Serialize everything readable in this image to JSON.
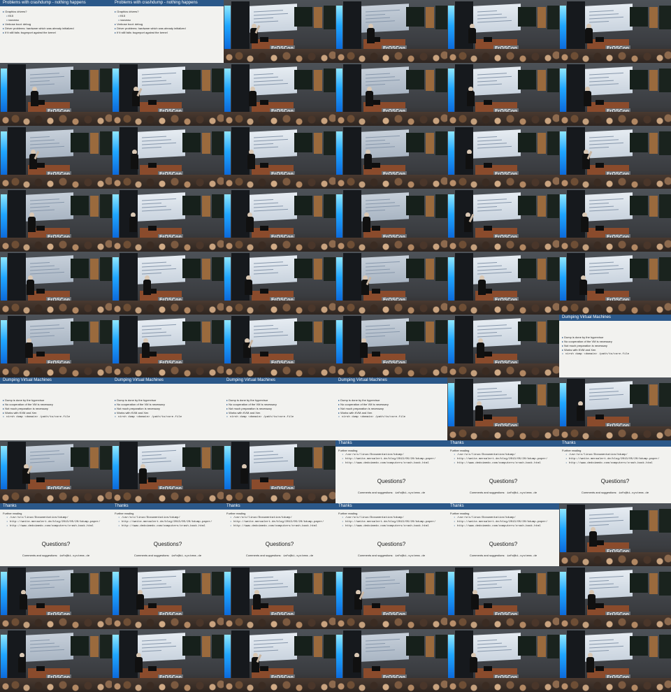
{
  "grid": {
    "columns": 6,
    "rows": 11
  },
  "logo_text": "FrOSCon",
  "slides": {
    "crashdump": {
      "title": "Problems with crashdump - nothing happens",
      "bullets": [
        {
          "text": "Graphics drivers?",
          "sub": [
            "i915",
            "nouveau"
          ]
        },
        {
          "text": "Verbose boot: debug",
          "sub": []
        },
        {
          "text": "Driver problems: hardware which was already initialized",
          "sub": []
        },
        {
          "text": "If it still fails: bugreport against the kernel",
          "sub": []
        }
      ]
    },
    "vm": {
      "title": "Dumping Virtual Machines",
      "bullets": [
        "Dump is done by the hypervisor",
        "No cooperation of the VM is necessary",
        "Not much preparation is necessary",
        "Works with KVM and Xen",
        "virsh dump <domain> /path/to/core.file"
      ]
    },
    "thanks": {
      "title": "Thanks",
      "intro": "Further reading",
      "links": [
        "/usr/src/linux/Documentation/kdump/",
        "http://weite.meraalert.de/blog/2013/05/20/kdump-paper/",
        "http://www.dedoimedo.com/computers/crash-book.html"
      ],
      "question": "Questions?",
      "contact_label": "Comments and suggestions:",
      "contact": "iafo@bi-systems.de"
    }
  },
  "tiles": [
    "crashdump",
    "crashdump",
    "photo",
    "photo",
    "photo",
    "photo",
    "photo",
    "photo",
    "photo",
    "photo",
    "photo",
    "photo",
    "photo",
    "photo",
    "photo",
    "photo",
    "photo",
    "photo",
    "photo",
    "photo",
    "photo",
    "photo",
    "photo",
    "photo",
    "photo",
    "photo",
    "photo",
    "photo",
    "photo",
    "photo",
    "photo",
    "photo",
    "photo",
    "photo",
    "photo",
    "vm",
    "vm",
    "vm",
    "vm",
    "vm",
    "photo",
    "photo",
    "photo",
    "photo",
    "photo",
    "thanks",
    "thanks",
    "thanks",
    "thanks",
    "thanks",
    "thanks",
    "thanks",
    "thanks",
    "photo",
    "photo",
    "photo",
    "photo",
    "photo",
    "photo",
    "photo",
    "photo",
    "photo",
    "photo",
    "photo",
    "photo",
    "photo"
  ]
}
